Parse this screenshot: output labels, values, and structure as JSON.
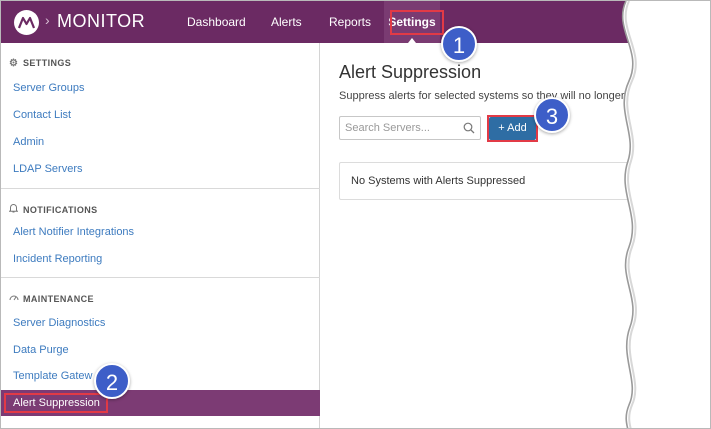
{
  "app": {
    "name": "MONITOR",
    "chevron": "›"
  },
  "nav": {
    "items": [
      "Dashboard",
      "Alerts",
      "Reports"
    ],
    "active": "Settings"
  },
  "sidebar": {
    "settings": {
      "heading": "SETTINGS",
      "items": [
        "Server Groups",
        "Contact List",
        "Admin",
        "LDAP Servers"
      ]
    },
    "notifications": {
      "heading": "NOTIFICATIONS",
      "items": [
        "Alert Notifier Integrations",
        "Incident Reporting"
      ]
    },
    "maintenance": {
      "heading": "MAINTENANCE",
      "items": [
        "Server Diagnostics",
        "Data Purge",
        "Template Gatew"
      ],
      "active": "Alert Suppression"
    }
  },
  "main": {
    "title": "Alert Suppression",
    "subtitle": "Suppress alerts for selected systems so they will no longer alert. All times are in UTC.",
    "search_placeholder": "Search Servers...",
    "add_label": "+ Add",
    "empty_message": "No Systems with Alerts Suppressed"
  },
  "callouts": [
    "1",
    "2",
    "3"
  ],
  "colors": {
    "topbar": "#6b2a63",
    "active_row": "#7c3b74",
    "link": "#3d7bbf",
    "button": "#2e6da4",
    "highlight": "#e23a46",
    "callout": "#3d5ec8"
  },
  "icons": {
    "settings": "gear-icon",
    "notifications": "bell-icon",
    "maintenance": "gauge-icon",
    "search": "search-icon",
    "logo": "monitor-logo-icon"
  }
}
